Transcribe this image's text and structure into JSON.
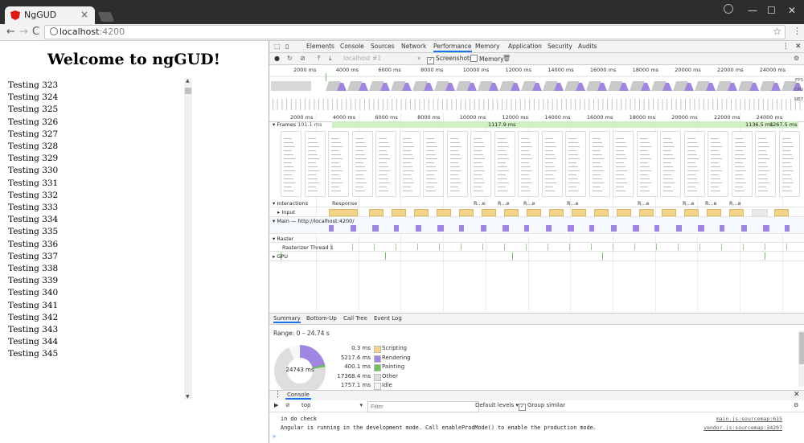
{
  "browser": {
    "tab_title": "NgGUD",
    "tab_close": "×",
    "url_host": "localhost",
    "url_port": ":4200",
    "win_min": "—",
    "win_max": "☐",
    "win_close": "✕",
    "back": "←",
    "forward": "→",
    "reload": "C"
  },
  "page": {
    "heading": "Welcome to ngGUD!",
    "items": [
      "Testing 323",
      "Testing 324",
      "Testing 325",
      "Testing 326",
      "Testing 327",
      "Testing 328",
      "Testing 329",
      "Testing 330",
      "Testing 331",
      "Testing 332",
      "Testing 333",
      "Testing 334",
      "Testing 335",
      "Testing 336",
      "Testing 337",
      "Testing 338",
      "Testing 339",
      "Testing 340",
      "Testing 341",
      "Testing 342",
      "Testing 343",
      "Testing 344",
      "Testing 345"
    ]
  },
  "devtools": {
    "tabs": [
      "Elements",
      "Console",
      "Sources",
      "Network",
      "Performance",
      "Memory",
      "Application",
      "Security",
      "Audits"
    ],
    "selected_tab": "Performance",
    "perf_toolbar": {
      "target": "localhost #1",
      "screenshots_label": "Screenshots",
      "memory_label": "Memory"
    },
    "overview_ticks": [
      "2000 ms",
      "4000 ms",
      "6000 ms",
      "8000 ms",
      "10000 ms",
      "12000 ms",
      "14000 ms",
      "16000 ms",
      "18000 ms",
      "20000 ms",
      "22000 ms",
      "24000 ms"
    ],
    "overview_labels": [
      "FPS",
      "CPU",
      "NET"
    ],
    "ruler_ticks": [
      "2000 ms",
      "4000 ms",
      "6000 ms",
      "8000 ms",
      "10000 ms",
      "12000 ms",
      "14000 ms",
      "16000 ms",
      "18000 ms",
      "20000 ms",
      "22000 ms",
      "24000 ms"
    ],
    "frames_label": "Frames",
    "frames_value": "101.1 ms",
    "frame_markers": [
      "1117.9 ms",
      "1136.5 ms",
      "1267.5 ms"
    ],
    "interactions_label": "Interactions",
    "response_label": "Response",
    "input_label": "Input",
    "re_labels": [
      "R...e",
      "R...e",
      "R...e",
      "R...e",
      "R...e",
      "R...e",
      "R...e",
      "R...e"
    ],
    "main_label": "Main — http://localhost:4200/",
    "raster_label": "Raster",
    "rasterizer_label": "Rasterizer Thread 1",
    "gpu_label": "GPU",
    "summary_tabs": [
      "Summary",
      "Bottom-Up",
      "Call Tree",
      "Event Log"
    ],
    "range": "Range: 0 – 24.74 s",
    "total": "24743 ms",
    "legend": [
      {
        "value": "0.3 ms",
        "label": "Scripting",
        "color": "#f2d38a"
      },
      {
        "value": "5217.6 ms",
        "label": "Rendering",
        "color": "#9f86e0"
      },
      {
        "value": "400.1 ms",
        "label": "Painting",
        "color": "#6fbf5f"
      },
      {
        "value": "17368.4 ms",
        "label": "Other",
        "color": "#dedede"
      },
      {
        "value": "1757.1 ms",
        "label": "Idle",
        "color": "#f7f7f7"
      }
    ],
    "console_tab": "Console",
    "console_context": "top",
    "filter_placeholder": "Filter",
    "levels": "Default levels ▾",
    "group_similar": "Group similar",
    "console_lines": [
      {
        "text": "in do check",
        "src": "main.js:sourcemap:615"
      },
      {
        "text": "Angular is running in the development mode. Call enableProdMode() to enable the production mode.",
        "src": "vendor.js:sourcemap:34207"
      }
    ],
    "prompt": ">"
  }
}
